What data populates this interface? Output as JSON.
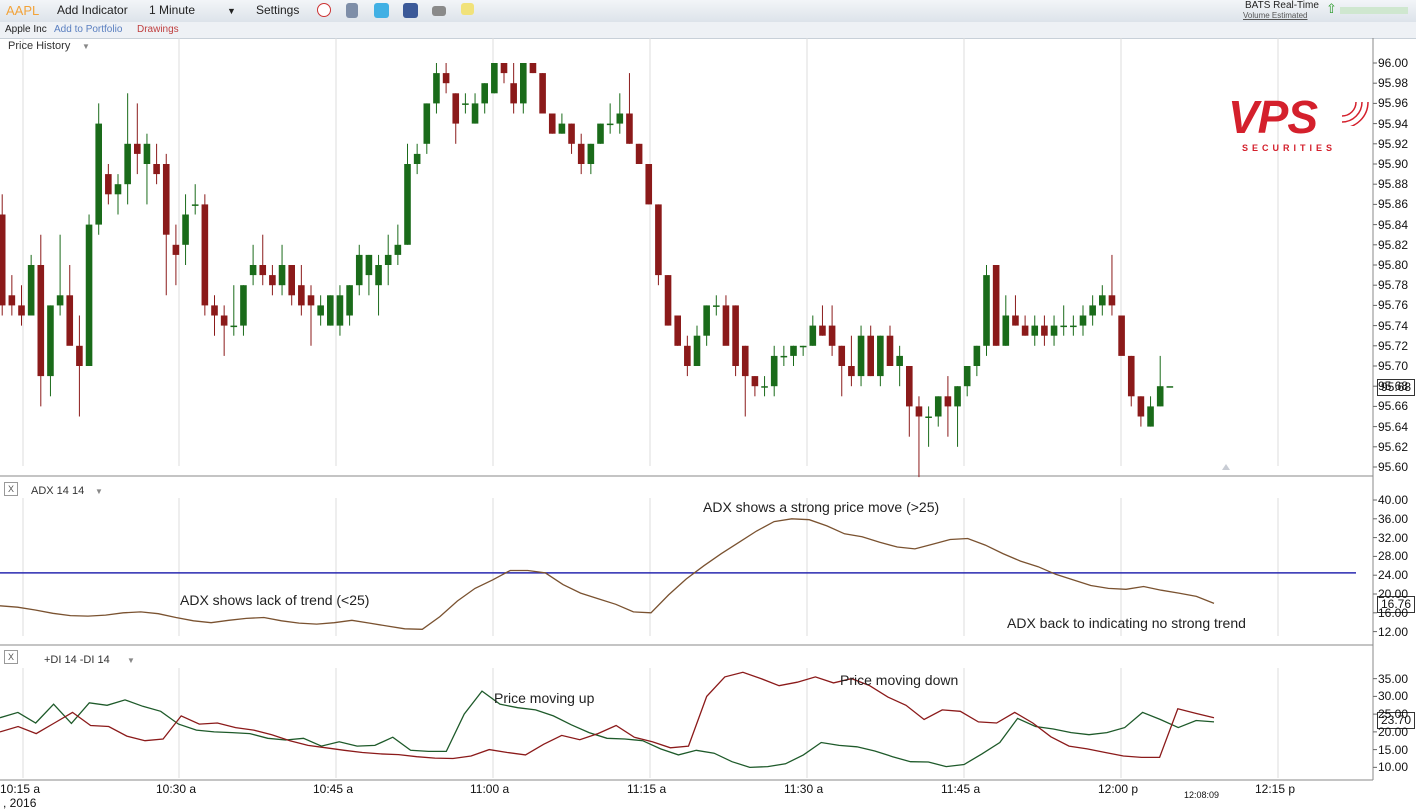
{
  "toolbar": {
    "symbol": "AAPL",
    "add_indicator": "Add Indicator",
    "interval": "1 Minute",
    "settings": "Settings",
    "feed": "BATS Real-Time",
    "volume_note": "Volume Estimated",
    "company": "Apple Inc",
    "add_portfolio": "Add to Portfolio",
    "drawings": "Drawings"
  },
  "watermark": {
    "brand": "VPS",
    "sub": "SECURITIES",
    "colors": {
      "red": "#d4202c",
      "gray": "#555555"
    }
  },
  "panels": {
    "price_label": "Price History",
    "adx_label": "ADX 14 14",
    "di_label": "+DI 14 -DI 14",
    "close_button": "X"
  },
  "annotations": {
    "adx_strong": "ADX shows a strong price move (>25)",
    "adx_lack": "ADX shows lack of trend (<25)",
    "adx_back": "ADX back to indicating no strong trend",
    "di_up": "Price moving up",
    "di_down": "Price moving down"
  },
  "footer": {
    "date": ", 2016",
    "time": "12:08:09"
  },
  "chart_data": [
    {
      "type": "candlestick",
      "title": "Price History",
      "x_tick_labels": [
        "10:15 a",
        "10:30 a",
        "10:45 a",
        "11:00 a",
        "11:15 a",
        "11:30 a",
        "11:45 a",
        "12:00 p",
        "12:15 p"
      ],
      "y_tick_labels": [
        "96.00",
        "95.98",
        "95.96",
        "95.94",
        "95.92",
        "95.90",
        "95.88",
        "95.86",
        "95.84",
        "95.82",
        "95.80",
        "95.78",
        "95.76",
        "95.74",
        "95.72",
        "95.70",
        "95.68",
        "95.66",
        "95.64",
        "95.62",
        "95.60"
      ],
      "ylim": [
        95.6,
        96.0
      ],
      "last_value": "95.68",
      "colors": {
        "up": "#1a6b1a",
        "down": "#8b1a1a"
      },
      "candles": [
        {
          "o": 95.85,
          "h": 95.87,
          "l": 95.75,
          "c": 95.76
        },
        {
          "o": 95.77,
          "h": 95.79,
          "l": 95.75,
          "c": 95.76
        },
        {
          "o": 95.76,
          "h": 95.78,
          "l": 95.74,
          "c": 95.75
        },
        {
          "o": 95.75,
          "h": 95.81,
          "l": 95.75,
          "c": 95.8
        },
        {
          "o": 95.8,
          "h": 95.83,
          "l": 95.66,
          "c": 95.69
        },
        {
          "o": 95.69,
          "h": 95.76,
          "l": 95.67,
          "c": 95.76
        },
        {
          "o": 95.76,
          "h": 95.83,
          "l": 95.75,
          "c": 95.77
        },
        {
          "o": 95.77,
          "h": 95.8,
          "l": 95.73,
          "c": 95.72
        },
        {
          "o": 95.72,
          "h": 95.75,
          "l": 95.65,
          "c": 95.7
        },
        {
          "o": 95.7,
          "h": 95.85,
          "l": 95.7,
          "c": 95.84
        },
        {
          "o": 95.84,
          "h": 95.96,
          "l": 95.83,
          "c": 95.94
        },
        {
          "o": 95.89,
          "h": 95.9,
          "l": 95.86,
          "c": 95.87
        },
        {
          "o": 95.87,
          "h": 95.89,
          "l": 95.85,
          "c": 95.88
        },
        {
          "o": 95.88,
          "h": 95.97,
          "l": 95.86,
          "c": 95.92
        },
        {
          "o": 95.92,
          "h": 95.96,
          "l": 95.89,
          "c": 95.91
        },
        {
          "o": 95.9,
          "h": 95.93,
          "l": 95.86,
          "c": 95.92
        },
        {
          "o": 95.9,
          "h": 95.92,
          "l": 95.88,
          "c": 95.89
        },
        {
          "o": 95.9,
          "h": 95.91,
          "l": 95.77,
          "c": 95.83
        },
        {
          "o": 95.82,
          "h": 95.84,
          "l": 95.78,
          "c": 95.81
        },
        {
          "o": 95.82,
          "h": 95.87,
          "l": 95.8,
          "c": 95.85
        },
        {
          "o": 95.86,
          "h": 95.88,
          "l": 95.85,
          "c": 95.86
        },
        {
          "o": 95.86,
          "h": 95.87,
          "l": 95.75,
          "c": 95.76
        },
        {
          "o": 95.76,
          "h": 95.77,
          "l": 95.73,
          "c": 95.75
        },
        {
          "o": 95.75,
          "h": 95.76,
          "l": 95.71,
          "c": 95.74
        },
        {
          "o": 95.74,
          "h": 95.78,
          "l": 95.73,
          "c": 95.74
        },
        {
          "o": 95.74,
          "h": 95.78,
          "l": 95.73,
          "c": 95.78
        },
        {
          "o": 95.79,
          "h": 95.82,
          "l": 95.78,
          "c": 95.8
        },
        {
          "o": 95.8,
          "h": 95.83,
          "l": 95.78,
          "c": 95.79
        },
        {
          "o": 95.79,
          "h": 95.8,
          "l": 95.77,
          "c": 95.78
        },
        {
          "o": 95.78,
          "h": 95.82,
          "l": 95.77,
          "c": 95.8
        },
        {
          "o": 95.8,
          "h": 95.8,
          "l": 95.76,
          "c": 95.77
        },
        {
          "o": 95.78,
          "h": 95.8,
          "l": 95.75,
          "c": 95.76
        },
        {
          "o": 95.77,
          "h": 95.78,
          "l": 95.72,
          "c": 95.76
        },
        {
          "o": 95.75,
          "h": 95.77,
          "l": 95.74,
          "c": 95.76
        },
        {
          "o": 95.74,
          "h": 95.77,
          "l": 95.74,
          "c": 95.77
        },
        {
          "o": 95.74,
          "h": 95.78,
          "l": 95.73,
          "c": 95.77
        },
        {
          "o": 95.75,
          "h": 95.78,
          "l": 95.74,
          "c": 95.78
        },
        {
          "o": 95.78,
          "h": 95.82,
          "l": 95.77,
          "c": 95.81
        },
        {
          "o": 95.79,
          "h": 95.81,
          "l": 95.77,
          "c": 95.81
        },
        {
          "o": 95.78,
          "h": 95.81,
          "l": 95.75,
          "c": 95.8
        },
        {
          "o": 95.8,
          "h": 95.83,
          "l": 95.78,
          "c": 95.81
        },
        {
          "o": 95.81,
          "h": 95.84,
          "l": 95.8,
          "c": 95.82
        },
        {
          "o": 95.82,
          "h": 95.92,
          "l": 95.82,
          "c": 95.9
        },
        {
          "o": 95.9,
          "h": 95.92,
          "l": 95.89,
          "c": 95.91
        },
        {
          "o": 95.92,
          "h": 95.96,
          "l": 95.91,
          "c": 95.96
        },
        {
          "o": 95.96,
          "h": 96.0,
          "l": 95.95,
          "c": 95.99
        },
        {
          "o": 95.99,
          "h": 96.0,
          "l": 95.97,
          "c": 95.98
        },
        {
          "o": 95.97,
          "h": 95.97,
          "l": 95.92,
          "c": 95.94
        },
        {
          "o": 95.96,
          "h": 95.97,
          "l": 95.95,
          "c": 95.96
        },
        {
          "o": 95.94,
          "h": 95.97,
          "l": 95.94,
          "c": 95.96
        },
        {
          "o": 95.96,
          "h": 95.98,
          "l": 95.95,
          "c": 95.98
        },
        {
          "o": 95.97,
          "h": 96.0,
          "l": 95.97,
          "c": 96.0
        },
        {
          "o": 96.0,
          "h": 96.0,
          "l": 95.98,
          "c": 95.99
        },
        {
          "o": 95.98,
          "h": 96.0,
          "l": 95.95,
          "c": 95.96
        },
        {
          "o": 95.96,
          "h": 96.0,
          "l": 95.95,
          "c": 96.0
        },
        {
          "o": 96.0,
          "h": 96.0,
          "l": 95.99,
          "c": 95.99
        },
        {
          "o": 95.99,
          "h": 95.99,
          "l": 95.95,
          "c": 95.95
        },
        {
          "o": 95.95,
          "h": 95.95,
          "l": 95.93,
          "c": 95.93
        },
        {
          "o": 95.93,
          "h": 95.95,
          "l": 95.93,
          "c": 95.94
        },
        {
          "o": 95.94,
          "h": 95.94,
          "l": 95.91,
          "c": 95.92
        },
        {
          "o": 95.92,
          "h": 95.93,
          "l": 95.89,
          "c": 95.9
        },
        {
          "o": 95.9,
          "h": 95.92,
          "l": 95.89,
          "c": 95.92
        },
        {
          "o": 95.92,
          "h": 95.94,
          "l": 95.92,
          "c": 95.94
        },
        {
          "o": 95.94,
          "h": 95.96,
          "l": 95.93,
          "c": 95.94
        },
        {
          "o": 95.94,
          "h": 95.97,
          "l": 95.93,
          "c": 95.95
        },
        {
          "o": 95.95,
          "h": 95.99,
          "l": 95.92,
          "c": 95.92
        },
        {
          "o": 95.92,
          "h": 95.92,
          "l": 95.9,
          "c": 95.9
        },
        {
          "o": 95.9,
          "h": 95.9,
          "l": 95.86,
          "c": 95.86
        },
        {
          "o": 95.86,
          "h": 95.86,
          "l": 95.78,
          "c": 95.79
        },
        {
          "o": 95.79,
          "h": 95.79,
          "l": 95.74,
          "c": 95.74
        },
        {
          "o": 95.75,
          "h": 95.75,
          "l": 95.72,
          "c": 95.72
        },
        {
          "o": 95.72,
          "h": 95.73,
          "l": 95.69,
          "c": 95.7
        },
        {
          "o": 95.7,
          "h": 95.74,
          "l": 95.7,
          "c": 95.73
        },
        {
          "o": 95.73,
          "h": 95.76,
          "l": 95.72,
          "c": 95.76
        },
        {
          "o": 95.76,
          "h": 95.77,
          "l": 95.75,
          "c": 95.76
        },
        {
          "o": 95.76,
          "h": 95.77,
          "l": 95.73,
          "c": 95.72
        },
        {
          "o": 95.76,
          "h": 95.76,
          "l": 95.69,
          "c": 95.7
        },
        {
          "o": 95.72,
          "h": 95.72,
          "l": 95.65,
          "c": 95.69
        },
        {
          "o": 95.69,
          "h": 95.69,
          "l": 95.67,
          "c": 95.68
        },
        {
          "o": 95.68,
          "h": 95.69,
          "l": 95.67,
          "c": 95.68
        },
        {
          "o": 95.68,
          "h": 95.72,
          "l": 95.67,
          "c": 95.71
        },
        {
          "o": 95.71,
          "h": 95.72,
          "l": 95.7,
          "c": 95.71
        },
        {
          "o": 95.71,
          "h": 95.72,
          "l": 95.7,
          "c": 95.72
        },
        {
          "o": 95.72,
          "h": 95.72,
          "l": 95.71,
          "c": 95.72
        },
        {
          "o": 95.72,
          "h": 95.75,
          "l": 95.72,
          "c": 95.74
        },
        {
          "o": 95.74,
          "h": 95.76,
          "l": 95.73,
          "c": 95.73
        },
        {
          "o": 95.74,
          "h": 95.76,
          "l": 95.71,
          "c": 95.72
        },
        {
          "o": 95.72,
          "h": 95.72,
          "l": 95.67,
          "c": 95.7
        },
        {
          "o": 95.7,
          "h": 95.73,
          "l": 95.68,
          "c": 95.69
        },
        {
          "o": 95.69,
          "h": 95.74,
          "l": 95.68,
          "c": 95.73
        },
        {
          "o": 95.73,
          "h": 95.74,
          "l": 95.69,
          "c": 95.69
        },
        {
          "o": 95.69,
          "h": 95.73,
          "l": 95.68,
          "c": 95.73
        },
        {
          "o": 95.73,
          "h": 95.74,
          "l": 95.7,
          "c": 95.7
        },
        {
          "o": 95.7,
          "h": 95.72,
          "l": 95.68,
          "c": 95.71
        },
        {
          "o": 95.7,
          "h": 95.7,
          "l": 95.63,
          "c": 95.66
        },
        {
          "o": 95.66,
          "h": 95.67,
          "l": 95.59,
          "c": 95.65
        },
        {
          "o": 95.65,
          "h": 95.66,
          "l": 95.62,
          "c": 95.65
        },
        {
          "o": 95.65,
          "h": 95.67,
          "l": 95.64,
          "c": 95.67
        },
        {
          "o": 95.67,
          "h": 95.69,
          "l": 95.63,
          "c": 95.66
        },
        {
          "o": 95.66,
          "h": 95.68,
          "l": 95.62,
          "c": 95.68
        },
        {
          "o": 95.68,
          "h": 95.7,
          "l": 95.67,
          "c": 95.7
        },
        {
          "o": 95.7,
          "h": 95.72,
          "l": 95.69,
          "c": 95.72
        },
        {
          "o": 95.72,
          "h": 95.8,
          "l": 95.71,
          "c": 95.79
        },
        {
          "o": 95.8,
          "h": 95.8,
          "l": 95.72,
          "c": 95.72
        },
        {
          "o": 95.72,
          "h": 95.77,
          "l": 95.72,
          "c": 95.75
        },
        {
          "o": 95.75,
          "h": 95.77,
          "l": 95.74,
          "c": 95.74
        },
        {
          "o": 95.74,
          "h": 95.75,
          "l": 95.73,
          "c": 95.73
        },
        {
          "o": 95.73,
          "h": 95.75,
          "l": 95.72,
          "c": 95.74
        },
        {
          "o": 95.74,
          "h": 95.75,
          "l": 95.72,
          "c": 95.73
        },
        {
          "o": 95.73,
          "h": 95.75,
          "l": 95.72,
          "c": 95.74
        },
        {
          "o": 95.74,
          "h": 95.76,
          "l": 95.73,
          "c": 95.74
        },
        {
          "o": 95.74,
          "h": 95.75,
          "l": 95.73,
          "c": 95.74
        },
        {
          "o": 95.74,
          "h": 95.76,
          "l": 95.73,
          "c": 95.75
        },
        {
          "o": 95.75,
          "h": 95.77,
          "l": 95.74,
          "c": 95.76
        },
        {
          "o": 95.76,
          "h": 95.78,
          "l": 95.75,
          "c": 95.77
        },
        {
          "o": 95.77,
          "h": 95.81,
          "l": 95.75,
          "c": 95.76
        },
        {
          "o": 95.75,
          "h": 95.75,
          "l": 95.72,
          "c": 95.71
        },
        {
          "o": 95.71,
          "h": 95.71,
          "l": 95.66,
          "c": 95.67
        },
        {
          "o": 95.67,
          "h": 95.67,
          "l": 95.64,
          "c": 95.65
        },
        {
          "o": 95.64,
          "h": 95.67,
          "l": 95.64,
          "c": 95.66
        },
        {
          "o": 95.66,
          "h": 95.71,
          "l": 95.66,
          "c": 95.68
        },
        {
          "o": 95.68,
          "h": 95.68,
          "l": 95.68,
          "c": 95.68
        }
      ]
    },
    {
      "type": "line",
      "title": "ADX 14 14",
      "ylim": [
        10,
        40
      ],
      "y_ticks": [
        12,
        16,
        20,
        24,
        28,
        32,
        36,
        40
      ],
      "y_tick_labels": [
        "12.00",
        "16.00",
        "20.00",
        "24.00",
        "28.00",
        "32.00",
        "36.00",
        "40.00"
      ],
      "reference_line": 24.5,
      "last_value": "16.76",
      "colors": {
        "line": "#7a5230",
        "reference": "#2a2ab0"
      },
      "series": [
        {
          "values": [
            17.5,
            17.2,
            16.6,
            15.9,
            15.4,
            15.3,
            15.5,
            16.0,
            16.2,
            15.8,
            15.0,
            14.3,
            13.9,
            14.4,
            14.8,
            15.0,
            14.3,
            13.8,
            13.6,
            13.9,
            14.4,
            13.8,
            13.2,
            12.6,
            12.5,
            15.2,
            18.5,
            21.2,
            23.0,
            25.0,
            25.0,
            24.5,
            22.0,
            20.2,
            19.0,
            17.8,
            16.2,
            16.0,
            19.8,
            23.2,
            26.0,
            28.6,
            31.0,
            33.4,
            35.4,
            36.0,
            35.8,
            34.5,
            32.8,
            32.2,
            31.0,
            30.0,
            29.6,
            30.6,
            31.6,
            31.8,
            30.4,
            28.6,
            27.0,
            25.8,
            24.2,
            23.0,
            21.8,
            21.2,
            21.0,
            21.6,
            20.8,
            20.2,
            19.5,
            18.0
          ]
        }
      ]
    },
    {
      "type": "line",
      "title": "+DI 14 -DI 14",
      "ylim": [
        7,
        38
      ],
      "y_ticks": [
        10,
        15,
        20,
        25,
        30,
        35
      ],
      "y_tick_labels": [
        "10.00",
        "15.00",
        "20.00",
        "25.00",
        "30.00",
        "35.00"
      ],
      "last_value": "23.70",
      "colors": {
        "plus_di": "#1e5a2a",
        "minus_di": "#8b1a1a"
      },
      "series": [
        {
          "values": [
            24,
            25.5,
            22.5,
            27.8,
            22.4,
            28.2,
            27.5,
            29,
            27.2,
            25.8,
            22.2,
            20.5,
            20,
            19.8,
            19.5,
            18.2,
            17.7,
            18.2,
            16,
            17.2,
            16,
            16.2,
            18.5,
            14.8,
            14.5,
            14.5,
            25,
            31.5,
            27.8,
            26.8,
            26.2,
            24.5,
            22,
            19.8,
            18.2,
            18,
            17.5,
            15.2,
            13.5,
            14.8,
            14,
            11.6,
            10,
            10.2,
            11,
            13.5,
            17,
            16.2,
            15.8,
            14.6,
            13,
            11.6,
            11.5,
            10.2,
            10.8,
            13.8,
            17,
            23.8,
            21.5,
            20.8,
            19.8,
            19.2,
            19.8,
            21.2,
            25.5,
            23.5,
            21.2,
            23.2,
            22.8
          ]
        },
        {
          "values": [
            20,
            21.5,
            19.5,
            22.5,
            25.5,
            21.8,
            21.5,
            18.8,
            17.5,
            18,
            24.5,
            22.2,
            22.5,
            21.2,
            20.5,
            19.2,
            17.5,
            16.2,
            15.5,
            14.8,
            14.2,
            13.8,
            13.6,
            13,
            12.6,
            12.5,
            13.2,
            15,
            14.2,
            13.5,
            16.5,
            19,
            17.8,
            19.5,
            21.8,
            18.5,
            17.2,
            15.5,
            16,
            30,
            35.5,
            36.8,
            35,
            33,
            34,
            35.5,
            33.8,
            35,
            33,
            29.8,
            27.5,
            23.5,
            26.2,
            25.8,
            22.8,
            22.5,
            25.5,
            22.5,
            18.6,
            16,
            15.2,
            14.2,
            13.2,
            12.8,
            12.8,
            26.5,
            25.2,
            24
          ]
        }
      ]
    }
  ]
}
